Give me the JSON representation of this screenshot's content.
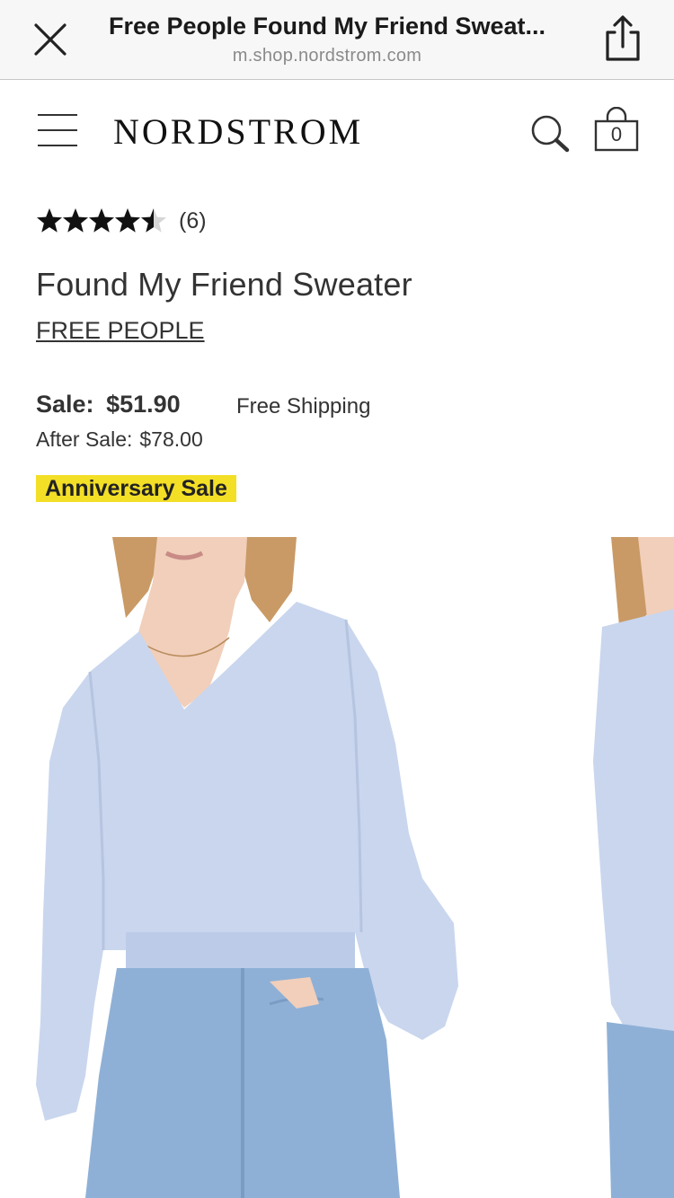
{
  "browser": {
    "title": "Free People Found My Friend Sweat...",
    "url": "m.shop.nordstrom.com"
  },
  "header": {
    "logo": "NORDSTROM",
    "bag_count": "0"
  },
  "product": {
    "rating": 4.5,
    "rating_max": 5,
    "review_count": "(6)",
    "title": "Found My Friend Sweater",
    "brand": "FREE PEOPLE",
    "sale_label": "Sale:",
    "sale_price": "$51.90",
    "shipping": "Free Shipping",
    "after_sale_label": "After Sale:",
    "after_sale_price": "$78.00",
    "badge": "Anniversary Sale"
  },
  "colors": {
    "badge_bg": "#f3df26",
    "sweater": "#c9d6ee",
    "denim": "#8fb0d6",
    "skin": "#f1cfba",
    "hair": "#c99a66"
  },
  "icons": {
    "close": "close-icon",
    "share": "share-icon",
    "menu": "hamburger-menu-icon",
    "search": "search-icon",
    "bag": "shopping-bag-icon",
    "star": "star-icon"
  }
}
